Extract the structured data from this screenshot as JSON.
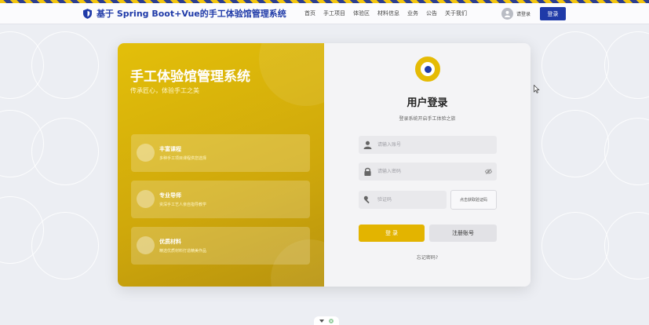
{
  "header": {
    "brand_title": "基于 Spring Boot+Vue的手工体验馆管理系统",
    "brand_icon": "shield-icon",
    "nav": [
      "首页",
      "手工项目",
      "体验区",
      "材料信息",
      "业务",
      "公告",
      "关于我们"
    ],
    "user_label": "请登录",
    "login_label": "登录"
  },
  "left_panel": {
    "title": "手工体验馆管理系统",
    "subtitle": "传承匠心，体验手工之美",
    "features": [
      {
        "title": "丰富课程",
        "desc": "多种手工项目课程供您选择"
      },
      {
        "title": "专业导师",
        "desc": "资深手工艺人亲自指导教学"
      },
      {
        "title": "优质材料",
        "desc": "精选优质材料打造精美作品"
      }
    ]
  },
  "login_form": {
    "title": "用户登录",
    "subtitle": "登录系统开启手工体验之旅",
    "username_placeholder": "请输入账号",
    "password_placeholder": "请输入密码",
    "captcha_placeholder": "验证码",
    "captcha_button": "点击获取验证码",
    "login_button": "登 录",
    "register_button": "注册账号",
    "forgot_link": "忘记密码?"
  },
  "colors": {
    "brand_blue": "#1f3aa8",
    "accent_gold": "#e3b400",
    "background": "#eceef3"
  }
}
